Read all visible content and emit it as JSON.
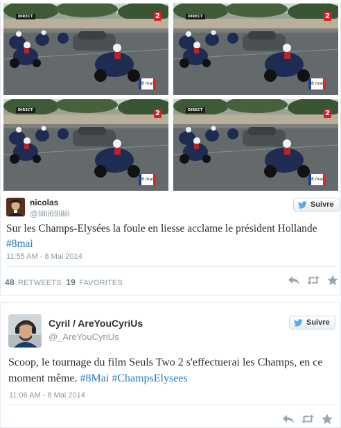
{
  "tweet1": {
    "media": {
      "frames": [
        {
          "badge": "DIRECT",
          "channel": "2",
          "tag": "8 mai"
        },
        {
          "badge": "DIRECT",
          "channel": "2",
          "tag": "8 mai"
        },
        {
          "badge": "DIRECT",
          "channel": "2",
          "tag": "8 mai"
        },
        {
          "badge": "DIRECT",
          "channel": "2",
          "tag": "8 mai"
        }
      ]
    },
    "author": {
      "name": "nicolas",
      "handle": "@lilili69lilili"
    },
    "follow_label": "Suivre",
    "text_before": "Sur les Champs-Elysées la foule en liesse acclame le président Hollande ",
    "hashtag": "#8mai",
    "timestamp": "11:55 AM - 8 Mai 2014",
    "retweets_count": "48",
    "retweets_label": "RETWEETS",
    "favorites_count": "19",
    "favorites_label": "FAVORITES",
    "action_icons": [
      "reply-icon",
      "retweet-icon",
      "favorite-icon"
    ]
  },
  "tweet2": {
    "author": {
      "name": "Cyril / AreYouCyriUs",
      "handle": "@_AreYouCyriUs"
    },
    "follow_label": "Suivre",
    "text_before": "Scoop, le tournage du film Seuls Two 2 s'effectuerai les Champs, en ce moment même. ",
    "hashtag1": "#8Mai",
    "hashtag2": "#ChampsElysees",
    "timestamp": "11:06 AM - 8 Mai 2014",
    "action_icons": [
      "reply-icon",
      "retweet-icon",
      "favorite-icon"
    ]
  },
  "colors": {
    "link": "#2b7bb9",
    "name": "#292f33",
    "meta": "#8899a6",
    "twitter_bird": "#55acee",
    "france_blue": "#1c3f94",
    "france_red": "#e0262d"
  }
}
